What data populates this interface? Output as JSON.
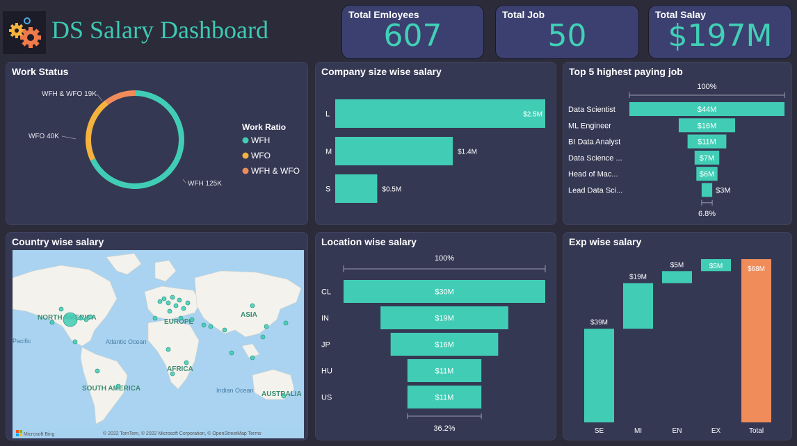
{
  "header": {
    "title": "DS Salary Dashboard"
  },
  "kpis": [
    {
      "label": "Total Emloyees",
      "value": "607"
    },
    {
      "label": "Total Job",
      "value": "50"
    },
    {
      "label": "Total Salay",
      "value": "$197M"
    }
  ],
  "colors": {
    "accent": "#41cdb5",
    "wfo": "#f5b33e",
    "wfh_wfo": "#ef8c5a",
    "total": "#ef8c5a",
    "panel": "#353853"
  },
  "map": {
    "labels": [
      "NORTH AMERICA",
      "EUROPE",
      "ASIA",
      "AFRICA",
      "SOUTH AMERICA",
      "AUSTRALIA",
      "Atlantic Ocean",
      "Indian Ocean",
      "Pacific"
    ],
    "footer": "© 2022 TomTom, © 2022 Microsoft Corporation, © OpenStreetMap Terms",
    "brand": "Microsoft Bing"
  },
  "chart_data": [
    {
      "type": "pie",
      "title": "Work Status",
      "legend_title": "Work Ratio",
      "legend_position": "right",
      "categories": [
        "WFH",
        "WFO",
        "WFH & WFO"
      ],
      "values": [
        125,
        40,
        19
      ],
      "data_labels": [
        "WFH 125K",
        "WFO 40K",
        "WFH & WFO 19K"
      ]
    },
    {
      "type": "bar",
      "title": "Company size wise salary",
      "orientation": "horizontal",
      "categories": [
        "L",
        "M",
        "S"
      ],
      "values": [
        2.5,
        1.4,
        0.5
      ],
      "data_labels": [
        "$2.5M",
        "$1.4M",
        "$0.5M"
      ]
    },
    {
      "type": "bar",
      "title": "Top 5 highest paying job",
      "style": "funnel",
      "top_label": "100%",
      "bottom_label": "6.8%",
      "categories": [
        "Data Scientist",
        "ML Engineer",
        "BI Data Analyst",
        "Data Science ...",
        "Head of Mac...",
        "Lead Data Sci..."
      ],
      "values": [
        44,
        16,
        11,
        7,
        6,
        3
      ],
      "data_labels": [
        "$44M",
        "$16M",
        "$11M",
        "$7M",
        "$6M",
        "$3M"
      ]
    },
    {
      "type": "scatter",
      "title": "Country wise salary",
      "style": "map"
    },
    {
      "type": "bar",
      "title": "Location wise salary",
      "style": "funnel",
      "top_label": "100%",
      "bottom_label": "36.2%",
      "categories": [
        "CL",
        "IN",
        "JP",
        "HU",
        "US"
      ],
      "values": [
        30,
        19,
        16,
        11,
        11
      ],
      "data_labels": [
        "$30M",
        "$19M",
        "$16M",
        "$11M",
        "$11M"
      ]
    },
    {
      "type": "bar",
      "title": "Exp wise salary",
      "style": "waterfall",
      "categories": [
        "SE",
        "MI",
        "EN",
        "EX",
        "Total"
      ],
      "values": [
        39,
        19,
        5,
        5,
        68
      ],
      "data_labels": [
        "$39M",
        "$19M",
        "$5M",
        "$5M",
        "$68M"
      ]
    }
  ]
}
